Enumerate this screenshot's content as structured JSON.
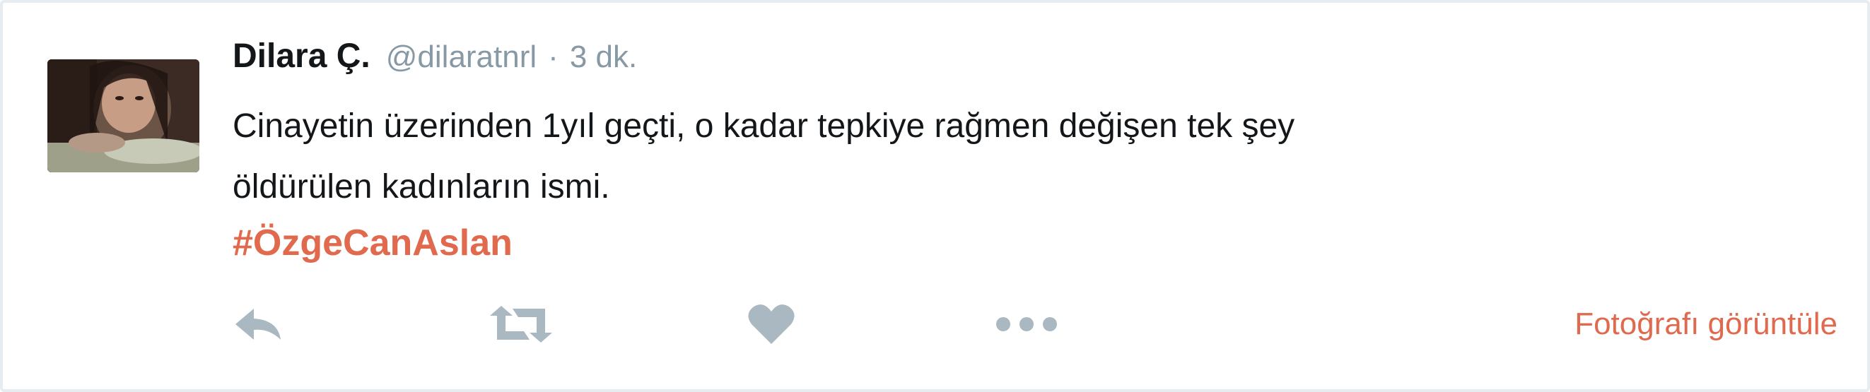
{
  "tweet": {
    "author_name": "Dilara Ç.",
    "author_handle": "@dilaratnrl",
    "separator": "·",
    "time": "3 dk.",
    "text_line1": "Cinayetin üzerinden 1yıl geçti, o kadar tepkiye rağmen değişen tek şey",
    "text_line2": "öldürülen kadınların ismi.",
    "hashtag": "#ÖzgeCanAslan"
  },
  "actions": {
    "reply_icon": "reply-icon",
    "retweet_icon": "retweet-icon",
    "like_icon": "heart-icon",
    "more_icon": "more-icon",
    "view_photo_label": "Fotoğrafı görüntüle"
  },
  "colors": {
    "text": "#14171a",
    "muted": "#8899a6",
    "icon": "#aab8c2",
    "accent": "#e0694e",
    "border": "#e6ecf0"
  }
}
